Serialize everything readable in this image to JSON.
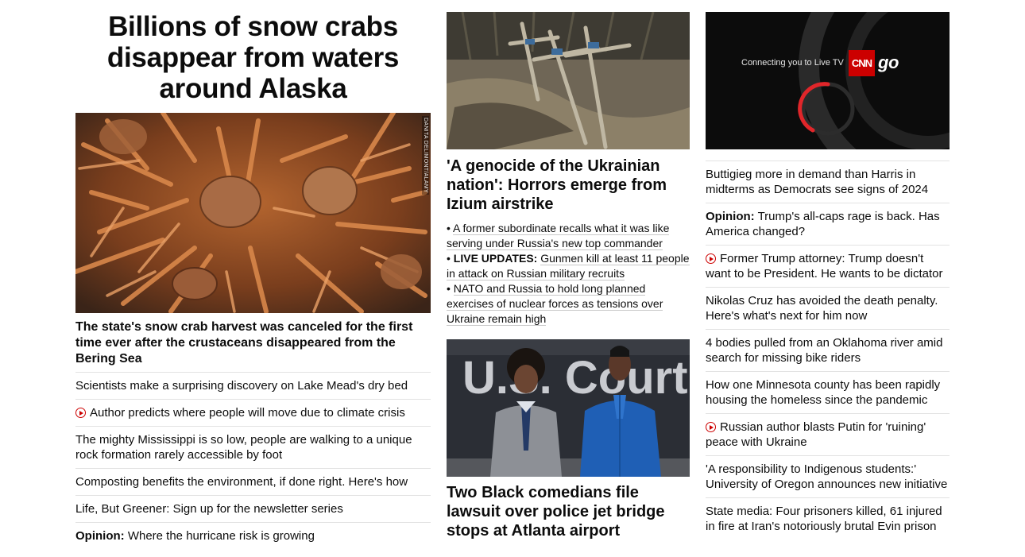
{
  "lead": {
    "headline": "Billions of snow crabs disappear from waters around Alaska",
    "photo_credit": "DANITA DELIMONT/ALAMY",
    "caption": "The state's snow crab harvest was canceled for the first time ever after the crustaceans disappeared from the Bering Sea"
  },
  "col1_items": [
    {
      "text": "Scientists make a surprising discovery on Lake Mead's dry bed"
    },
    {
      "text": "Author predicts where people will move due to climate crisis",
      "video": true
    },
    {
      "text": "The mighty Mississippi is so low, people are walking to a unique rock formation rarely accessible by foot"
    },
    {
      "text": "Composting benefits the environment, if done right. Here's how"
    },
    {
      "text": "Life, But Greener: Sign up for the newsletter series"
    },
    {
      "prefix": "Opinion:",
      "text": "Where the hurricane risk is growing"
    }
  ],
  "ukraine": {
    "headline": "'A genocide of the Ukrainian nation': Horrors emerge from Izium airstrike",
    "bullets": [
      {
        "text": "A former subordinate recalls what it was like serving under Russia's new top commander"
      },
      {
        "prefix": "LIVE UPDATES:",
        "text": "Gunmen kill at least 11 people in attack on Russian military recruits"
      },
      {
        "text": "NATO and Russia to hold long planned exercises of nuclear forces as tensions over Ukraine remain high"
      }
    ]
  },
  "comedians": {
    "headline": "Two Black comedians file lawsuit over police jet bridge stops at Atlanta airport",
    "sign_text": "U.S. Court"
  },
  "video": {
    "connecting_text": "Connecting you to Live TV",
    "logo_text": "CNN",
    "go_text": "go"
  },
  "col3_items": [
    {
      "text": "Buttigieg more in demand than Harris in midterms as Democrats see signs of 2024"
    },
    {
      "prefix": "Opinion:",
      "text": "Trump's all-caps rage is back. Has America changed?"
    },
    {
      "text": "Former Trump attorney: Trump doesn't want to be President. He wants to be dictator",
      "video": true
    },
    {
      "text": "Nikolas Cruz has avoided the death penalty. Here's what's next for him now"
    },
    {
      "text": "4 bodies pulled from an Oklahoma river amid search for missing bike riders"
    },
    {
      "text": "How one Minnesota county has been rapidly housing the homeless since the pandemic"
    },
    {
      "text": "Russian author blasts Putin for 'ruining' peace with Ukraine",
      "video": true
    },
    {
      "text": "'A responsibility to Indigenous students:' University of Oregon announces new initiative"
    },
    {
      "text": "State media: Four prisoners killed, 61 injured in fire at Iran's notoriously brutal Evin prison"
    }
  ],
  "colors": {
    "accent": "#cc0000",
    "text": "#0c0c0c",
    "divider": "#e2e2e2"
  }
}
